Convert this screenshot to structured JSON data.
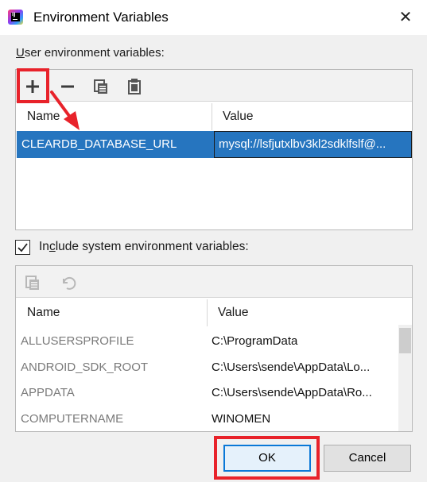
{
  "window": {
    "title": "Environment Variables",
    "close_glyph": "✕"
  },
  "user_vars": {
    "label_prefix": "U",
    "label_rest": "ser environment variables:",
    "toolbar": {
      "add_icon": "plus-icon",
      "remove_icon": "minus-icon",
      "copy_icon": "copy-icon",
      "paste_icon": "paste-icon"
    },
    "columns": {
      "name": "Name",
      "value": "Value"
    },
    "rows": [
      {
        "name": "CLEARDB_DATABASE_URL",
        "value": "mysql://lsfjutxlbv3kl2sdklfslf@...",
        "selected": true
      }
    ]
  },
  "system_vars": {
    "checkbox_checked": true,
    "label_pre": "In",
    "label_underlined": "c",
    "label_post": "lude system environment variables:",
    "toolbar": {
      "copy_icon": "copy-icon",
      "revert_icon": "undo-icon"
    },
    "columns": {
      "name": "Name",
      "value": "Value"
    },
    "rows": [
      {
        "name": "ALLUSERSPROFILE",
        "value": "C:\\ProgramData"
      },
      {
        "name": "ANDROID_SDK_ROOT",
        "value": "C:\\Users\\sende\\AppData\\Lo..."
      },
      {
        "name": "APPDATA",
        "value": "C:\\Users\\sende\\AppData\\Ro..."
      },
      {
        "name": "COMPUTERNAME",
        "value": "WINOMEN"
      }
    ]
  },
  "buttons": {
    "ok": "OK",
    "cancel": "Cancel"
  },
  "colors": {
    "selection": "#2675bf",
    "highlight": "#e8222a",
    "ok_border": "#0a78d7"
  }
}
